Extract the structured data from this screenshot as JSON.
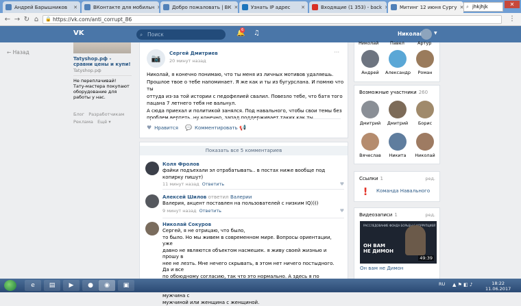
{
  "browser": {
    "tabs": [
      {
        "title": "Андрей Барышников",
        "color": "#5181b8"
      },
      {
        "title": "ВКонтакте для мобильн",
        "color": "#5181b8"
      },
      {
        "title": "Добро пожаловать | ВК",
        "color": "#5181b8"
      },
      {
        "title": "Узнать IP адрес",
        "color": "#1c75bc"
      },
      {
        "title": "Входящие (1 353) - back",
        "color": "#d93025"
      },
      {
        "title": "Митинг 12 июня Сургу",
        "color": "#5181b8"
      }
    ],
    "new_tab_input": "jhkjhjk",
    "url": "https://vk.com/anti_corrupt_86"
  },
  "vk": {
    "search_placeholder": "Поиск",
    "notif_count": "6",
    "user_name": "Николай"
  },
  "left": {
    "back_label": "Назад",
    "ad_title": "Tatyshop.рф - сравни цены и купи!",
    "ad_site": "Tatyshop.рф",
    "ad_sub_title": "Не переплачивай!",
    "ad_sub_text": "Тату-мастера покупают оборудование для работы у нас.",
    "footer_links": [
      "Блог",
      "Разработчикам",
      "Реклама",
      "Ещё ▾"
    ]
  },
  "post": {
    "author": "Сергей Дмитриев",
    "time": "20 минут назад",
    "text_lines": [
      "Николай, я конечно понимаю, что ты меня из личных мотивов удаляешь.",
      "Прошлое твое о тебе напоминает. Я же как и ты из бугурслана. И помню что ты",
      "оттуда из-за той истории с педофелией свалил. Повезло тебе, что батя того",
      "пацана 7 летнего тебя не вальнул.",
      "А сюда приехал и политикой занялся. Под навального, чтобы свои темы без",
      "проблем вертеть. ну конечно, запад поддерживает таких как ты."
    ],
    "like_label": "Нравится",
    "comment_label": "Комментировать"
  },
  "comments": {
    "show_all": "Показать все 5 комментариев",
    "reply_label": "Ответить",
    "items": [
      {
        "author": "Коля Фролов",
        "replied_to": "",
        "text": "файки подъехали эл отрабатывать.. в постах ниже вообще под копирку пишут)",
        "time": "11 минут назад",
        "avatar_color": "#3b3f49"
      },
      {
        "author": "Алексей Шилов",
        "reply_word": "ответил",
        "replied_to": "Валерии",
        "text": "Валерия, акцент поставлен на пользователей с низким IQ))))",
        "time": "9 минут назад",
        "avatar_color": "#55585e"
      },
      {
        "author": "Николай Сокуров",
        "replied_to": "",
        "text_lines": [
          "Сергей, я не отрицаю, что было,",
          "то было. Но мы живем в современном мире. Вопросы ориентации, уже",
          "давно не являются объектом насмешек. я живу своей жизнью и прошу в",
          "нее не лезть. Мне нечего скрывать, в этом нет ничего постыдного. Да и все",
          "по обоюдному согласию, так что это нормально. А здесь я по другому",
          "поводу. Каждый может любить того кого хочет, пусть это будет мужчина с",
          "мужчиной или женщина с женщиной."
        ],
        "avatar_color": "#7a6c5d"
      }
    ]
  },
  "right": {
    "members_top_names": [
      "Николай",
      "Павел",
      "Артур"
    ],
    "members_row": [
      {
        "name": "Андрей",
        "color": "#6d7480"
      },
      {
        "name": "Александр",
        "color": "#5aa7d6"
      },
      {
        "name": "Роман",
        "color": "#9a7b5c"
      }
    ],
    "possible_title": "Возможные участники",
    "possible_count": "260",
    "possible": [
      {
        "name": "Дмитрий",
        "color": "#8a8f96"
      },
      {
        "name": "Дмитрий",
        "color": "#7d6b58"
      },
      {
        "name": "Борис",
        "color": "#a08a6b"
      },
      {
        "name": "Вячеслав",
        "color": "#b58c6e"
      },
      {
        "name": "Никита",
        "color": "#5f7d9e"
      },
      {
        "name": "Николай",
        "color": "#9e7b62"
      }
    ],
    "links_title": "Ссылки",
    "links_count": "1",
    "edit_label": "ред.",
    "link_name": "Команда Навального",
    "videos_title": "Видеозаписи",
    "videos_count": "1",
    "video_overlay_top": "РАССЛЕДОВАНИЕ ФОНДА БОРЬБЫ С КОРРУПЦИЕЙ",
    "video_overlay_line1": "ОН ВАМ",
    "video_overlay_line2": "НЕ ДИМОН",
    "video_duration": "49:39",
    "video_title": "Он вам не Димон"
  },
  "taskbar": {
    "lang": "RU",
    "time": "18:22",
    "date": "11.06.2017"
  }
}
